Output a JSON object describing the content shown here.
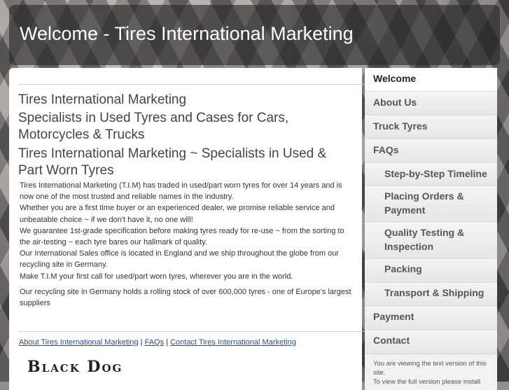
{
  "header": {
    "title": "Welcome - Tires International Marketing"
  },
  "main": {
    "heading1": "Tires International Marketing",
    "heading2": "Specialists in Used Tyres and Cases for Cars, Motorcycles & Trucks",
    "heading3": "Tires International Marketing ~ Specialists in Used & Part Worn Tyres",
    "paragraph1": [
      "Tires International Marketing (T.I.M) has traded in used/part worn tyres for over 14 years and is now one of the most trusted and reliable names in the industry.",
      "Whether you are a first time buyer or an experienced dealer, we promise reliable service and unbeatable choice ~ if we don't have it, no one will!",
      "We guarantee 1st-grade specification before making tyres ready for re-use ~ from the sorting to the air-testing ~ each tyre bares our hallmark of quality.",
      "Our International Sales office is located in England and we ship throughout the globe from our recycling site in Germany.",
      "Make T.I.M your first call for used/part worn tyres, wherever you are in the world."
    ],
    "paragraph2": "Our recycling site in Germany holds a rolling stock of over 600,000 tyres - one of Europe's largest suppliers",
    "footer_links": {
      "about": "About Tires International Marketing",
      "separator": "|",
      "faqs": "FAQs",
      "contact": "Contact Tires International Marketing"
    },
    "logo_text": "Black Dog"
  },
  "sidebar": {
    "items": [
      {
        "label": "Welcome"
      },
      {
        "label": "About Us"
      },
      {
        "label": "Truck Tyres"
      },
      {
        "label": "FAQs"
      },
      {
        "label": "Step-by-Step Timeline"
      },
      {
        "label": "Placing Orders & Payment"
      },
      {
        "label": "Quality Testing & Inspection"
      },
      {
        "label": "Packing"
      },
      {
        "label": "Transport & Shipping"
      },
      {
        "label": "Payment"
      },
      {
        "label": "Contact"
      }
    ],
    "note": "You are viewing the text version of this site.",
    "note2": "To view the full version please install"
  }
}
